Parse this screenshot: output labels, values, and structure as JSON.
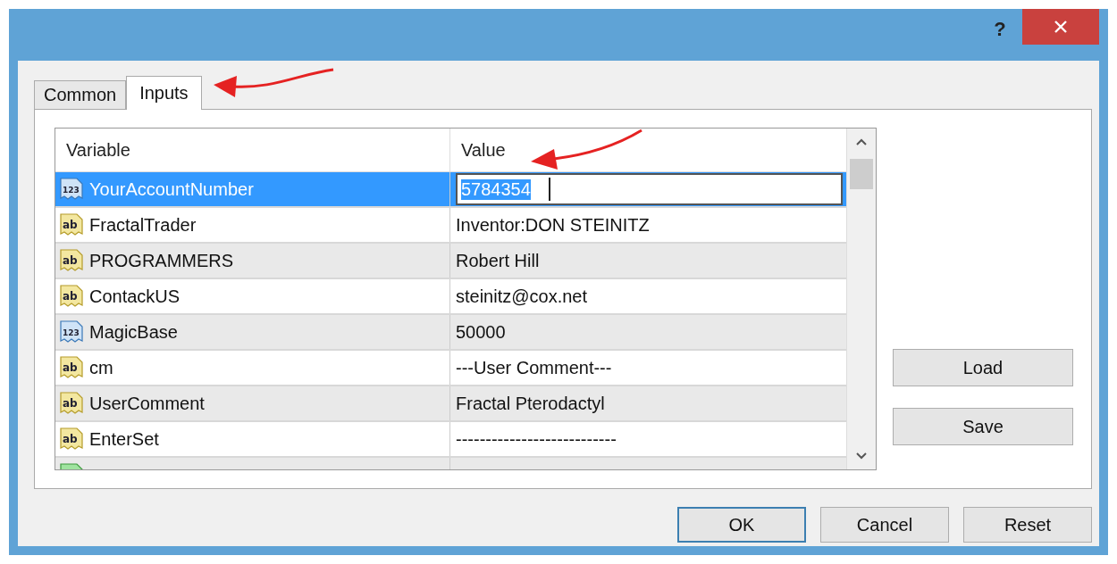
{
  "window": {
    "help": "?"
  },
  "tabs": [
    {
      "label": "Common",
      "selected": false
    },
    {
      "label": "Inputs",
      "selected": true
    }
  ],
  "table": {
    "columns": [
      "Variable",
      "Value"
    ],
    "rows": [
      {
        "kind": "number",
        "icon_label": "123",
        "name": "YourAccountNumber",
        "value": "5784354",
        "selected": true
      },
      {
        "kind": "text",
        "icon_label": "ab",
        "name": "FractalTrader",
        "value": "Inventor:DON STEINITZ",
        "selected": false
      },
      {
        "kind": "text",
        "icon_label": "ab",
        "name": "PROGRAMMERS",
        "value": "Robert Hill",
        "selected": false
      },
      {
        "kind": "text",
        "icon_label": "ab",
        "name": "ContackUS",
        "value": "steinitz@cox.net",
        "selected": false
      },
      {
        "kind": "number",
        "icon_label": "123",
        "name": "MagicBase",
        "value": "50000",
        "selected": false
      },
      {
        "kind": "text",
        "icon_label": "ab",
        "name": "cm",
        "value": "---User Comment---",
        "selected": false
      },
      {
        "kind": "text",
        "icon_label": "ab",
        "name": "UserComment",
        "value": "Fractal Pterodactyl",
        "selected": false
      },
      {
        "kind": "text",
        "icon_label": "ab",
        "name": "EnterSet",
        "value": "---------------------------",
        "selected": false
      },
      {
        "kind": "bool",
        "selected": false
      }
    ]
  },
  "side_buttons": [
    "Load",
    "Save"
  ],
  "buttons": [
    {
      "label": "OK",
      "default": true
    },
    {
      "label": "Cancel",
      "default": false
    },
    {
      "label": "Reset",
      "default": false
    }
  ]
}
